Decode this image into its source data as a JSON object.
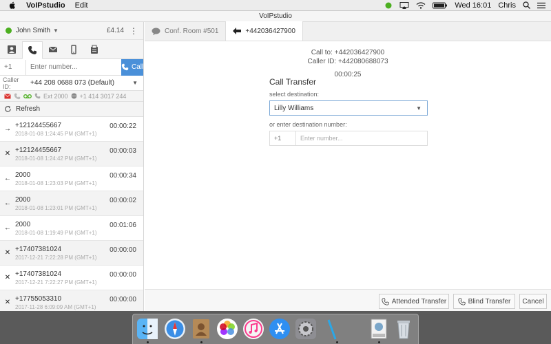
{
  "menubar": {
    "app_name": "VoIPstudio",
    "menu_edit": "Edit",
    "clock": "Wed 16:01",
    "user": "Chris"
  },
  "window": {
    "title": "VoIPstudio"
  },
  "account": {
    "name": "John Smith",
    "balance": "£4.14"
  },
  "dialer": {
    "country_code": "+1",
    "number_placeholder": "Enter number...",
    "call_label": "Call",
    "caller_id_label": "Caller ID:",
    "caller_id_value": "+44 208 0688 073 (Default)"
  },
  "status": {
    "extension": "Ext 2000",
    "phone": "+1 414 3017 244"
  },
  "refresh_label": "Refresh",
  "calls": [
    {
      "dir": "→",
      "number": "+12124455667",
      "date": "2018-01-08 1:24:45 PM (GMT+1)",
      "duration": "00:00:22"
    },
    {
      "dir": "✕",
      "number": "+12124455667",
      "date": "2018-01-08 1:24:42 PM (GMT+1)",
      "duration": "00:00:03"
    },
    {
      "dir": "←",
      "number": "2000",
      "date": "2018-01-08 1:23:03 PM (GMT+1)",
      "duration": "00:00:34"
    },
    {
      "dir": "←",
      "number": "2000",
      "date": "2018-01-08 1:23:01 PM (GMT+1)",
      "duration": "00:00:02"
    },
    {
      "dir": "←",
      "number": "2000",
      "date": "2018-01-08 1:19:49 PM (GMT+1)",
      "duration": "00:01:06"
    },
    {
      "dir": "✕",
      "number": "+17407381024",
      "date": "2017-12-21 7:22:28 PM (GMT+1)",
      "duration": "00:00:00"
    },
    {
      "dir": "✕",
      "number": "+17407381024",
      "date": "2017-12-21 7:22:27 PM (GMT+1)",
      "duration": "00:00:00"
    },
    {
      "dir": "✕",
      "number": "+17755053310",
      "date": "2017-11-28 6:09:09 AM (GMT+1)",
      "duration": "00:00:00"
    }
  ],
  "tabs": [
    {
      "label": "Conf. Room #501"
    },
    {
      "label": "+442036427900"
    }
  ],
  "call_info": {
    "call_to": "Call to: +442036427900",
    "caller_id": "Caller ID: +442080688073",
    "timer": "00:00:25"
  },
  "transfer": {
    "title": "Call Transfer",
    "select_label": "select destination:",
    "selected": "Lilly Williams",
    "or_label": "or enter destination number:",
    "country_code": "+1",
    "number_placeholder": "Enter number..."
  },
  "buttons": {
    "attended": "Attended Transfer",
    "blind": "Blind Transfer",
    "cancel": "Cancel"
  },
  "dock_icons": [
    "finder-icon",
    "safari-icon",
    "contacts-icon",
    "photos-icon",
    "itunes-icon",
    "app-store-icon",
    "system-preferences-icon",
    "pen-icon",
    "preview-icon",
    "trash-icon"
  ]
}
